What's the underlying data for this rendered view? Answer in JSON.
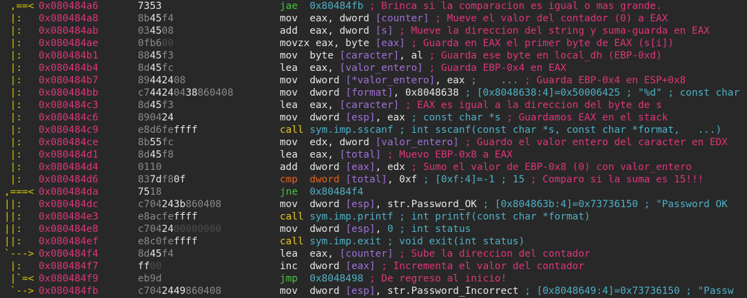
{
  "terminal": {
    "rows": [
      {
        "flow": " ,==< ",
        "addr": "0x080484a6",
        "bytes": [
          [
            "7353",
            "h"
          ]
        ],
        "disasm": [
          [
            "jae",
            "jmp"
          ],
          [
            "  ",
            "text"
          ],
          [
            "0x80484fb",
            "num"
          ],
          [
            " ; Brinca si la comparacion es igual o mas grande.",
            "cmt"
          ]
        ]
      },
      {
        "flow": " |:  ",
        "addr": "0x080484a8",
        "bytes": [
          [
            "8b",
            "d"
          ],
          [
            "45",
            "h"
          ],
          [
            "f4",
            "d"
          ]
        ],
        "disasm": [
          [
            "mov",
            "mov"
          ],
          [
            "  ",
            "text"
          ],
          [
            "eax, dword ",
            "reg"
          ],
          [
            "[counter]",
            "mem"
          ],
          [
            " ; Mueve el valor del contador (0) a EAX",
            "cmt"
          ]
        ]
      },
      {
        "flow": " |:  ",
        "addr": "0x080484ab",
        "bytes": [
          [
            "03",
            "d"
          ],
          [
            "45",
            "h"
          ],
          [
            "08",
            "d"
          ]
        ],
        "disasm": [
          [
            "add",
            "mov"
          ],
          [
            "  ",
            "text"
          ],
          [
            "eax, dword ",
            "reg"
          ],
          [
            "[s]",
            "mem"
          ],
          [
            " ; Mueve la direccion del string y suma-guarda en EAX",
            "cmt"
          ]
        ]
      },
      {
        "flow": " |:  ",
        "addr": "0x080484ae",
        "bytes": [
          [
            "0fb6",
            "d"
          ],
          [
            "00",
            "g"
          ]
        ],
        "disasm": [
          [
            "movzx",
            "mov"
          ],
          [
            " eax, byte ",
            "reg"
          ],
          [
            "[eax]",
            "mem"
          ],
          [
            " ; Guarda en EAX el primer byte de EAX (s[i])",
            "cmt"
          ]
        ]
      },
      {
        "flow": " |:  ",
        "addr": "0x080484b1",
        "bytes": [
          [
            "88",
            "d"
          ],
          [
            "45",
            "h"
          ],
          [
            "f3",
            "d"
          ]
        ],
        "disasm": [
          [
            "mov",
            "mov"
          ],
          [
            "  ",
            "text"
          ],
          [
            "byte ",
            "reg"
          ],
          [
            "[caracter]",
            "mem"
          ],
          [
            ", al",
            "reg"
          ],
          [
            " ; Guarda ese byte en local_dh (EBP-0xd)",
            "cmt"
          ]
        ]
      },
      {
        "flow": " |:  ",
        "addr": "0x080484b4",
        "bytes": [
          [
            "8d",
            "d"
          ],
          [
            "45",
            "h"
          ],
          [
            "fc",
            "d"
          ]
        ],
        "disasm": [
          [
            "lea",
            "mov"
          ],
          [
            "  ",
            "text"
          ],
          [
            "eax, ",
            "reg"
          ],
          [
            "[valor_entero]",
            "mem"
          ],
          [
            " ; Guarda EBP-0x4 en EAX",
            "cmt"
          ]
        ]
      },
      {
        "flow": " |:  ",
        "addr": "0x080484b7",
        "bytes": [
          [
            "89",
            "d"
          ],
          [
            "4424",
            "h"
          ],
          [
            "08",
            "d"
          ]
        ],
        "disasm": [
          [
            "mov",
            "mov"
          ],
          [
            "  ",
            "text"
          ],
          [
            "dword ",
            "reg"
          ],
          [
            "[*valor_entero]",
            "mem"
          ],
          [
            ", eax ",
            "reg"
          ],
          [
            ";    ... ",
            "cyan"
          ],
          [
            "; Guarda EBP-0x4 en ESP+0x8",
            "cmt"
          ]
        ]
      },
      {
        "flow": " |:  ",
        "addr": "0x080484bb",
        "bytes": [
          [
            "c7",
            "d"
          ],
          [
            "4424",
            "h"
          ],
          [
            "04",
            "d"
          ],
          [
            "38",
            "h"
          ],
          [
            "860408",
            "d"
          ]
        ],
        "disasm": [
          [
            "mov",
            "mov"
          ],
          [
            "  ",
            "text"
          ],
          [
            "dword ",
            "reg"
          ],
          [
            "[format]",
            "mem"
          ],
          [
            ", 0x8048638 ",
            "reg"
          ],
          [
            "; [0x8048638:4]=0x50006425 ; \"%d\" ; const char",
            "cyan"
          ]
        ]
      },
      {
        "flow": " |:  ",
        "addr": "0x080484c3",
        "bytes": [
          [
            "8d",
            "d"
          ],
          [
            "45",
            "h"
          ],
          [
            "f3",
            "d"
          ]
        ],
        "disasm": [
          [
            "lea",
            "mov"
          ],
          [
            "  ",
            "text"
          ],
          [
            "eax, ",
            "reg"
          ],
          [
            "[caracter]",
            "mem"
          ],
          [
            " ; EAX es igual a la direccion del byte de s",
            "cmt"
          ]
        ]
      },
      {
        "flow": " |:  ",
        "addr": "0x080484c6",
        "bytes": [
          [
            "8904",
            "d"
          ],
          [
            "24",
            "h"
          ]
        ],
        "disasm": [
          [
            "mov",
            "mov"
          ],
          [
            "  ",
            "text"
          ],
          [
            "dword ",
            "reg"
          ],
          [
            "[esp]",
            "mem"
          ],
          [
            ", eax ",
            "reg"
          ],
          [
            "; const char *s ",
            "cyan"
          ],
          [
            "; Guardamos EAX en el stack",
            "cmt"
          ]
        ]
      },
      {
        "flow": " |:  ",
        "addr": "0x080484c9",
        "bytes": [
          [
            "e8d6fe",
            "d"
          ],
          [
            "ffff",
            "h"
          ]
        ],
        "disasm": [
          [
            "call",
            "call"
          ],
          [
            " ",
            "text"
          ],
          [
            "sym.imp.sscanf",
            "sym"
          ],
          [
            " ; int sscanf(const char *s, const char *format,   ...)",
            "cyan"
          ]
        ]
      },
      {
        "flow": " |:  ",
        "addr": "0x080484ce",
        "bytes": [
          [
            "8b",
            "d"
          ],
          [
            "55",
            "h"
          ],
          [
            "fc",
            "d"
          ]
        ],
        "disasm": [
          [
            "mov",
            "mov"
          ],
          [
            "  ",
            "text"
          ],
          [
            "edx, dword ",
            "reg"
          ],
          [
            "[valor_entero]",
            "mem"
          ],
          [
            " ; Guardo el valor entero del caracter en EDX",
            "cmt"
          ]
        ]
      },
      {
        "flow": " |:  ",
        "addr": "0x080484d1",
        "bytes": [
          [
            "8d",
            "d"
          ],
          [
            "45",
            "h"
          ],
          [
            "f8",
            "d"
          ]
        ],
        "disasm": [
          [
            "lea",
            "mov"
          ],
          [
            "  ",
            "text"
          ],
          [
            "eax, ",
            "reg"
          ],
          [
            "[total]",
            "mem"
          ],
          [
            " ; Muevo EBP-0x8 a EAX",
            "cmt"
          ]
        ]
      },
      {
        "flow": " |:  ",
        "addr": "0x080484d4",
        "bytes": [
          [
            "0110",
            "d"
          ]
        ],
        "disasm": [
          [
            "add",
            "mov"
          ],
          [
            "  ",
            "text"
          ],
          [
            "dword ",
            "reg"
          ],
          [
            "[eax]",
            "mem"
          ],
          [
            ", edx",
            "reg"
          ],
          [
            " ; Sumo el valor de EBP-0x8 (0) con valor_entero",
            "cmt"
          ]
        ]
      },
      {
        "flow": " |:  ",
        "addr": "0x080484d6",
        "bytes": [
          [
            "83",
            "d"
          ],
          [
            "7d",
            "h"
          ],
          [
            "f8",
            "d"
          ],
          [
            "0f",
            "h"
          ]
        ],
        "disasm": [
          [
            "cmp",
            "cmp"
          ],
          [
            "  ",
            "text"
          ],
          [
            "dword ",
            "cmp"
          ],
          [
            "[total]",
            "mem"
          ],
          [
            ", 0xf ",
            "reg"
          ],
          [
            "; [0xf:4]=-1 ; 15 ",
            "cyan"
          ],
          [
            "; Comparo si la suma es 15!!!",
            "cmt"
          ]
        ]
      },
      {
        "flow": ",===< ",
        "addr": "0x080484da",
        "bytes": [
          [
            "75",
            "h"
          ],
          [
            "18",
            "d"
          ]
        ],
        "disasm": [
          [
            "jne",
            "jmp"
          ],
          [
            "  ",
            "text"
          ],
          [
            "0x80484f4",
            "num"
          ]
        ]
      },
      {
        "flow": "||:  ",
        "addr": "0x080484dc",
        "bytes": [
          [
            "c704",
            "d"
          ],
          [
            "243b",
            "h"
          ],
          [
            "860408",
            "d"
          ]
        ],
        "disasm": [
          [
            "mov",
            "mov"
          ],
          [
            "  ",
            "text"
          ],
          [
            "dword ",
            "reg"
          ],
          [
            "[esp]",
            "mem"
          ],
          [
            ", str.Password_OK ",
            "reg"
          ],
          [
            "; [0x804863b:4]=0x73736150 ; \"Password OK",
            "cyan"
          ]
        ]
      },
      {
        "flow": "||:  ",
        "addr": "0x080484e3",
        "bytes": [
          [
            "e8acfe",
            "d"
          ],
          [
            "ffff",
            "h"
          ]
        ],
        "disasm": [
          [
            "call",
            "call"
          ],
          [
            " ",
            "text"
          ],
          [
            "sym.imp.printf",
            "sym"
          ],
          [
            " ; int printf(const char *format)",
            "cyan"
          ]
        ]
      },
      {
        "flow": "||:  ",
        "addr": "0x080484e8",
        "bytes": [
          [
            "c704",
            "d"
          ],
          [
            "24",
            "h"
          ],
          [
            "00000000",
            "g"
          ]
        ],
        "disasm": [
          [
            "mov",
            "mov"
          ],
          [
            "  ",
            "text"
          ],
          [
            "dword ",
            "reg"
          ],
          [
            "[esp]",
            "mem"
          ],
          [
            ", ",
            "reg"
          ],
          [
            "0",
            "num"
          ],
          [
            " ; int status",
            "cyan"
          ]
        ]
      },
      {
        "flow": "||:  ",
        "addr": "0x080484ef",
        "bytes": [
          [
            "e8c0fe",
            "d"
          ],
          [
            "ffff",
            "h"
          ]
        ],
        "disasm": [
          [
            "call",
            "call"
          ],
          [
            " ",
            "text"
          ],
          [
            "sym.imp.exit",
            "sym"
          ],
          [
            " ; void exit(int status)",
            "cyan"
          ]
        ]
      },
      {
        "flow": "`---> ",
        "addr": "0x080484f4",
        "bytes": [
          [
            "8d",
            "d"
          ],
          [
            "45",
            "h"
          ],
          [
            "f4",
            "d"
          ]
        ],
        "disasm": [
          [
            "lea",
            "mov"
          ],
          [
            "  ",
            "text"
          ],
          [
            "eax, ",
            "reg"
          ],
          [
            "[counter]",
            "mem"
          ],
          [
            " ; Sube la direccion del contador",
            "cmt"
          ]
        ]
      },
      {
        "flow": " |:  ",
        "addr": "0x080484f7",
        "bytes": [
          [
            "ff",
            "h"
          ],
          [
            "00",
            "g"
          ]
        ],
        "disasm": [
          [
            "inc",
            "mov"
          ],
          [
            "  ",
            "text"
          ],
          [
            "dword ",
            "reg"
          ],
          [
            "[eax]",
            "mem"
          ],
          [
            " ; Incrementa el valor del contador",
            "cmt"
          ]
        ]
      },
      {
        "flow": " |`=< ",
        "addr": "0x080484f9",
        "bytes": [
          [
            "eb9d",
            "d"
          ]
        ],
        "disasm": [
          [
            "jmp",
            "jmp"
          ],
          [
            "  ",
            "text"
          ],
          [
            "0x8048498",
            "num"
          ],
          [
            " ; De regreso al inicio!",
            "cmt"
          ]
        ]
      },
      {
        "flow": " `--> ",
        "addr": "0x080484fb",
        "bytes": [
          [
            "c704",
            "d"
          ],
          [
            "2449",
            "h"
          ],
          [
            "860408",
            "d"
          ]
        ],
        "disasm": [
          [
            "mov",
            "mov"
          ],
          [
            "  ",
            "text"
          ],
          [
            "dword ",
            "reg"
          ],
          [
            "[esp]",
            "mem"
          ],
          [
            ", str.Password_Incorrect ",
            "reg"
          ],
          [
            "; [0x8048649:4]=0x73736150 ; \"Passw",
            "cyan"
          ]
        ]
      }
    ],
    "colors": {
      "background": "#282828",
      "address": "#e0357a",
      "flow": "#d7c800",
      "comment": "#e0357a",
      "jump": "#44c444",
      "call": "#e6c620",
      "cmp": "#e06020",
      "memory": "#a070d8",
      "number": "#4fb0c6"
    }
  }
}
